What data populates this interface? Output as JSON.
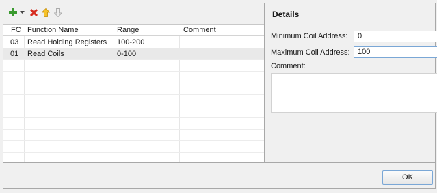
{
  "toolbar": {
    "icons": [
      "add-icon",
      "dropdown-arrow-icon",
      "delete-icon",
      "move-up-icon",
      "move-down-icon"
    ]
  },
  "table": {
    "columns": [
      "FC",
      "Function Name",
      "Range",
      "Comment"
    ],
    "rows": [
      {
        "fc": "03",
        "name": "Read Holding Registers",
        "range": "100-200",
        "comment": ""
      },
      {
        "fc": "01",
        "name": "Read Coils",
        "range": "0-100",
        "comment": ""
      }
    ]
  },
  "details": {
    "title": "Details",
    "min_label": "Minimum Coil Address:",
    "min_value": "0",
    "max_label": "Maximum Coil Address:",
    "max_value": "100",
    "comment_label": "Comment:"
  },
  "buttons": {
    "ok": "OK"
  },
  "colors": {
    "add": "#3a9a2f",
    "delete": "#d62b1f",
    "arrow": "#f2b300",
    "focus": "#7aa7d6"
  }
}
